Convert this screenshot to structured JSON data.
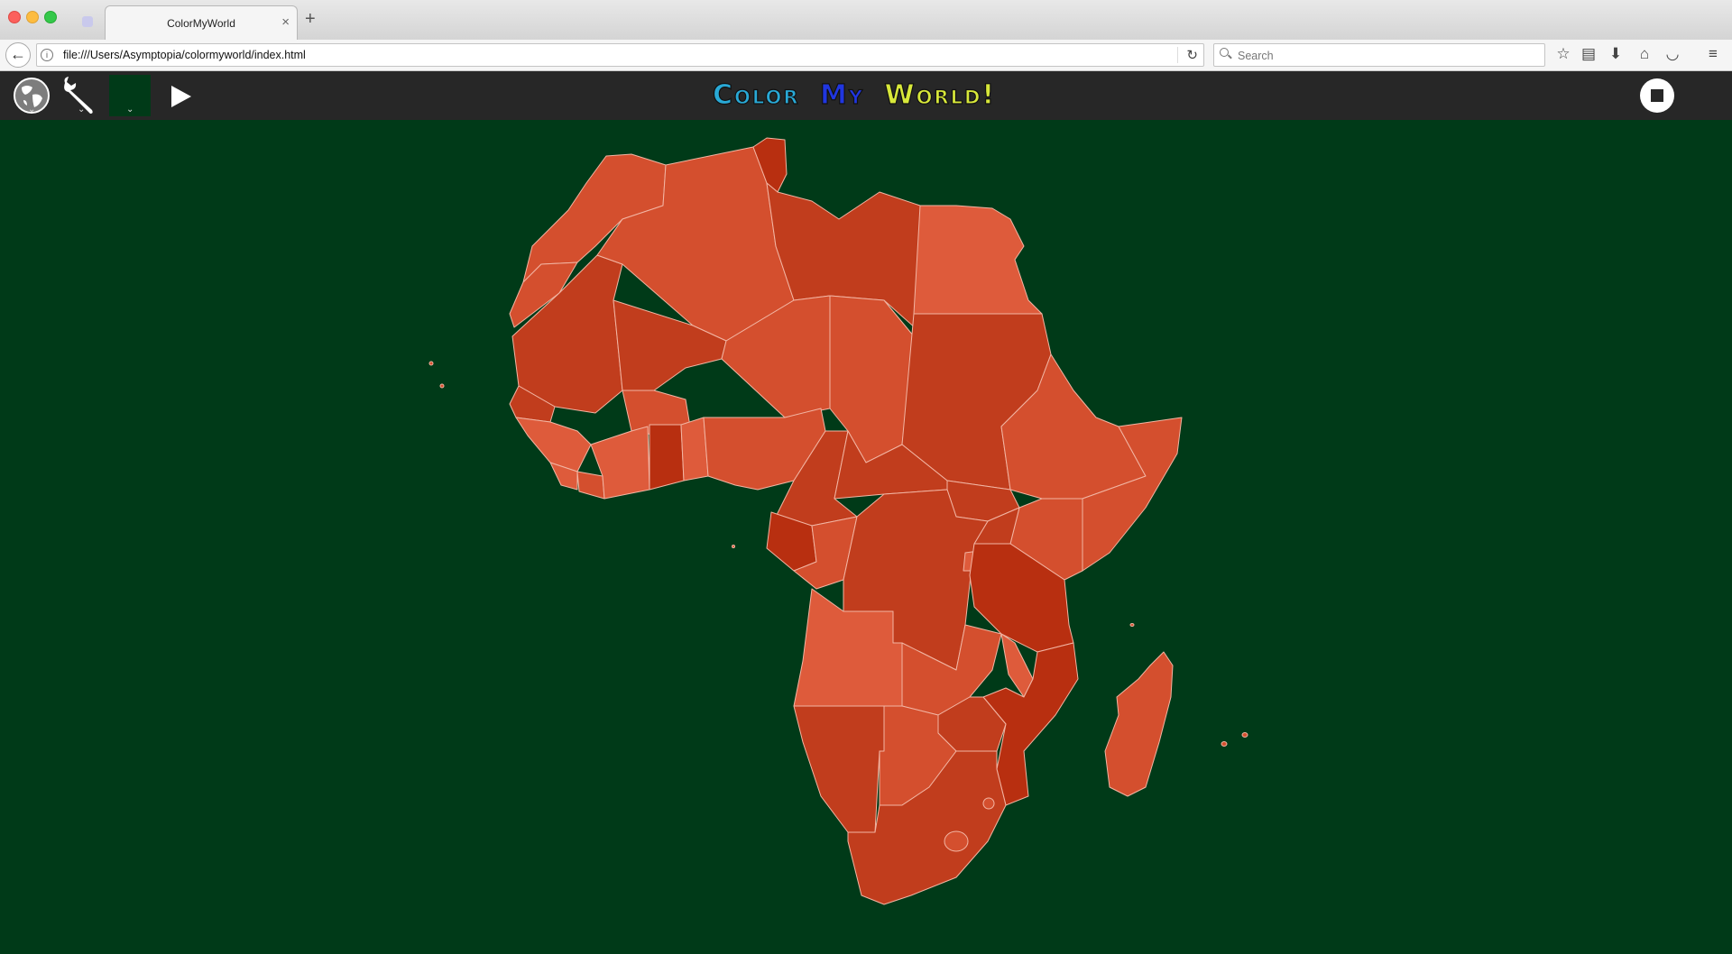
{
  "browser": {
    "tab_title": "ColorMyWorld",
    "url": "file:///Users/Asymptopia/colormyworld/index.html",
    "search_placeholder": "Search"
  },
  "app": {
    "title_words": [
      "Color",
      "My",
      "World!"
    ],
    "title_colors": [
      "#29a9d6",
      "#e8305a",
      "#2036e0",
      "#d8e83a",
      "#7de030",
      "#e84ad8"
    ],
    "background_color": "#003a18",
    "toolbar_color": "#272727"
  },
  "map": {
    "region": "Africa",
    "fill_shades": [
      "#d44f2e",
      "#c13d1d",
      "#de5b3b",
      "#b82f10"
    ],
    "border_color": "#f2b5a3"
  }
}
